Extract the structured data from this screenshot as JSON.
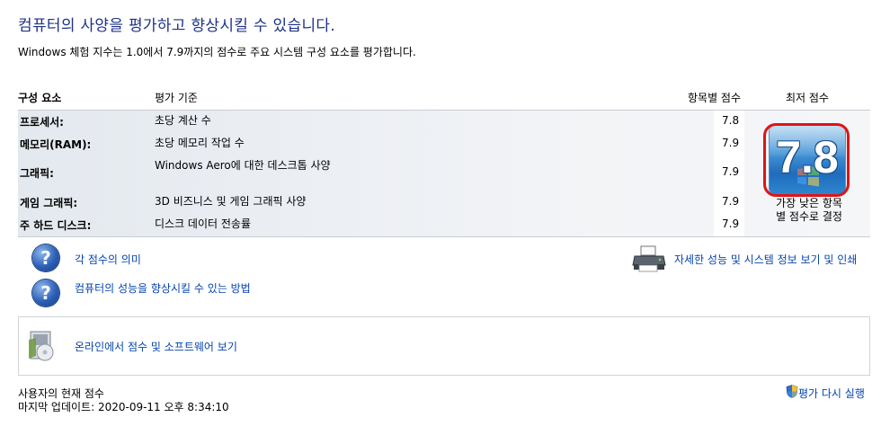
{
  "title": "컴퓨터의 사양을 평가하고 향상시킬 수 있습니다.",
  "subtitle": "Windows 체험 지수는 1.0에서 7.9까지의 점수로 주요 시스템 구성 요소를 평가합니다.",
  "table": {
    "headers": {
      "component": "구성 요소",
      "criteria": "평가 기준",
      "subscore": "항목별 점수",
      "basescore": "최저 점수"
    },
    "rows": [
      {
        "component": "프로세서:",
        "criteria": "초당 계산 수",
        "score": "7.8"
      },
      {
        "component": "메모리(RAM):",
        "criteria": "초당 메모리 작업 수",
        "score": "7.9"
      },
      {
        "component": "그래픽:",
        "criteria": "Windows Aero에 대한 데스크톱 사양",
        "score": "7.9"
      },
      {
        "component": "게임 그래픽:",
        "criteria": "3D 비즈니스 및 게임 그래픽 사양",
        "score": "7.9"
      },
      {
        "component": "주 하드 디스크:",
        "criteria": "디스크 데이터 전송률",
        "score": "7.9"
      }
    ]
  },
  "base_score": {
    "value": "7.8",
    "caption_line1": "가장 낮은 항목",
    "caption_line2": "별 점수로 결정"
  },
  "links": {
    "meaning": "각 점수의 의미",
    "improve": "컴퓨터의 성능을 향상시킬 수 있는 방법",
    "print": "자세한 성능 및 시스템 정보 보기 및 인쇄",
    "online": "온라인에서 점수 및 소프트웨어 보기",
    "rerun": "평가 다시 실행"
  },
  "footer": {
    "status": "사용자의 현재 점수",
    "last_update": "마지막 업데이트: 2020-09-11 오후 8:34:10"
  },
  "icons": {
    "help": "help-question-icon",
    "printer": "printer-icon",
    "software": "software-box-icon",
    "shield": "uac-shield-icon"
  },
  "colors": {
    "title": "#1e3287",
    "link": "#0645ad",
    "highlight": "#e01414"
  }
}
